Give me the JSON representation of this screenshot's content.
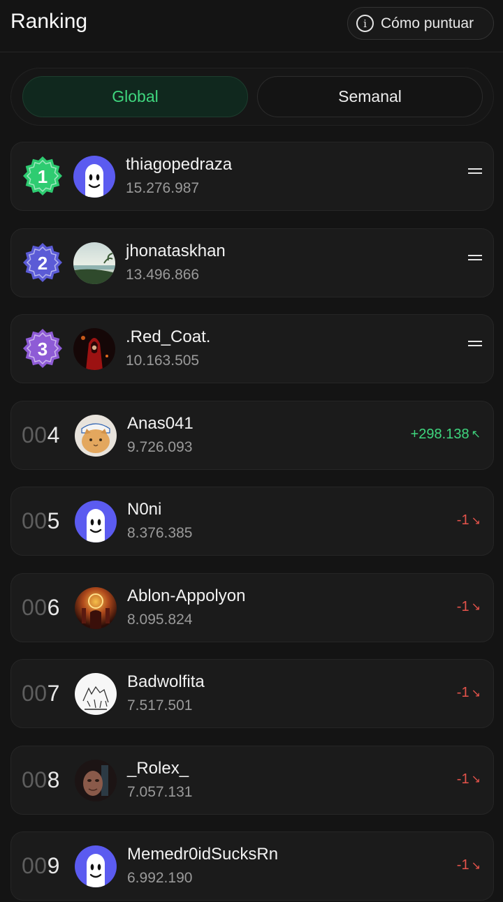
{
  "header": {
    "title": "Ranking",
    "how_to_label": "Cómo puntuar",
    "info_icon": "info-icon"
  },
  "tabs": [
    {
      "label": "Global",
      "active": true
    },
    {
      "label": "Semanal",
      "active": false
    }
  ],
  "colors": {
    "accent_green": "#3fd67e",
    "down_red": "#e5534b",
    "badge_1": "#2ecc71",
    "badge_2": "#5b5bd6",
    "badge_3": "#8e5bd6"
  },
  "rows": [
    {
      "rank": "1",
      "username": "thiagopedraza",
      "score": "15.276.987",
      "change": "",
      "trend": "same",
      "avatar": "ghost-avatar"
    },
    {
      "rank": "2",
      "username": "jhonataskhan",
      "score": "13.496.866",
      "change": "",
      "trend": "same",
      "avatar": "beach-avatar"
    },
    {
      "rank": "3",
      "username": ".Red_Coat.",
      "score": "10.163.505",
      "change": "",
      "trend": "same",
      "avatar": "red-hood-avatar"
    },
    {
      "rank_pad": "00",
      "rank": "4",
      "username": "Anas041",
      "score": "9.726.093",
      "change": "+298.138",
      "trend": "up",
      "avatar": "cat-avatar"
    },
    {
      "rank_pad": "00",
      "rank": "5",
      "username": "N0ni",
      "score": "8.376.385",
      "change": "-1",
      "trend": "down",
      "avatar": "ghost-avatar"
    },
    {
      "rank_pad": "00",
      "rank": "6",
      "username": "Ablon-Appolyon",
      "score": "8.095.824",
      "change": "-1",
      "trend": "down",
      "avatar": "throne-avatar"
    },
    {
      "rank_pad": "00",
      "rank": "7",
      "username": "Badwolfita",
      "score": "7.517.501",
      "change": "-1",
      "trend": "down",
      "avatar": "wolf-avatar"
    },
    {
      "rank_pad": "00",
      "rank": "8",
      "username": "_Rolex_",
      "score": "7.057.131",
      "change": "-1",
      "trend": "down",
      "avatar": "portrait-avatar"
    },
    {
      "rank_pad": "00",
      "rank": "9",
      "username": "Memedr0idSucksRn",
      "score": "6.992.190",
      "change": "-1",
      "trend": "down",
      "avatar": "ghost-avatar"
    }
  ]
}
